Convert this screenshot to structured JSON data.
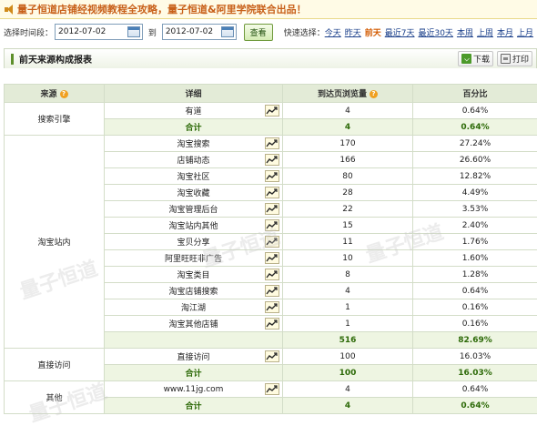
{
  "banner": {
    "text": "量子恒道店铺经视频教程全攻略，量子恒道&阿里学院联合出品！",
    "icon": "speaker-icon"
  },
  "toolbar": {
    "range_label": "选择时间段：",
    "start_date": "2012-07-02",
    "to_label": "到",
    "end_date": "2012-07-02",
    "view_button": "查看",
    "quick_label": "快速选择：",
    "quick_links": [
      "今天",
      "昨天",
      "前天",
      "最近7天",
      "最近30天",
      "本周",
      "上周",
      "本月",
      "上月"
    ],
    "active_quick": "前天"
  },
  "panel": {
    "title": "前天来源构成报表",
    "download": "下载",
    "print": "打印"
  },
  "table": {
    "headers": [
      "来源",
      "详细",
      "到达页浏览量",
      "百分比"
    ],
    "groups": [
      {
        "source": "搜索引擎",
        "rows": [
          {
            "detail": "有道",
            "pv": "4",
            "pct": "0.64%"
          }
        ],
        "total": {
          "label": "合计",
          "pv": "4",
          "pct": "0.64%"
        }
      },
      {
        "source": "淘宝站内",
        "rows": [
          {
            "detail": "淘宝搜索",
            "pv": "170",
            "pct": "27.24%"
          },
          {
            "detail": "店铺动态",
            "pv": "166",
            "pct": "26.60%"
          },
          {
            "detail": "淘宝社区",
            "pv": "80",
            "pct": "12.82%"
          },
          {
            "detail": "淘宝收藏",
            "pv": "28",
            "pct": "4.49%"
          },
          {
            "detail": "淘宝管理后台",
            "pv": "22",
            "pct": "3.53%"
          },
          {
            "detail": "淘宝站内其他",
            "pv": "15",
            "pct": "2.40%"
          },
          {
            "detail": "宝贝分享",
            "pv": "11",
            "pct": "1.76%"
          },
          {
            "detail": "阿里旺旺非广告",
            "pv": "10",
            "pct": "1.60%"
          },
          {
            "detail": "淘宝类目",
            "pv": "8",
            "pct": "1.28%"
          },
          {
            "detail": "淘宝店铺搜索",
            "pv": "4",
            "pct": "0.64%"
          },
          {
            "detail": "淘江湖",
            "pv": "1",
            "pct": "0.16%"
          },
          {
            "detail": "淘宝其他店铺",
            "pv": "1",
            "pct": "0.16%"
          }
        ],
        "total": {
          "label": "",
          "pv": "516",
          "pct": "82.69%"
        }
      },
      {
        "source": "直接访问",
        "rows": [
          {
            "detail": "直接访问",
            "pv": "100",
            "pct": "16.03%"
          }
        ],
        "total": {
          "label": "合计",
          "pv": "100",
          "pct": "16.03%"
        }
      },
      {
        "source": "其他",
        "rows": [
          {
            "detail": "www.11jg.com",
            "pv": "4",
            "pct": "0.64%"
          }
        ],
        "total": {
          "label": "合计",
          "pv": "4",
          "pct": "0.64%"
        }
      }
    ]
  },
  "colors": {
    "accent_green": "#2d6a08",
    "header_bg": "#e3ebd7",
    "banner_text": "#c8601a"
  }
}
